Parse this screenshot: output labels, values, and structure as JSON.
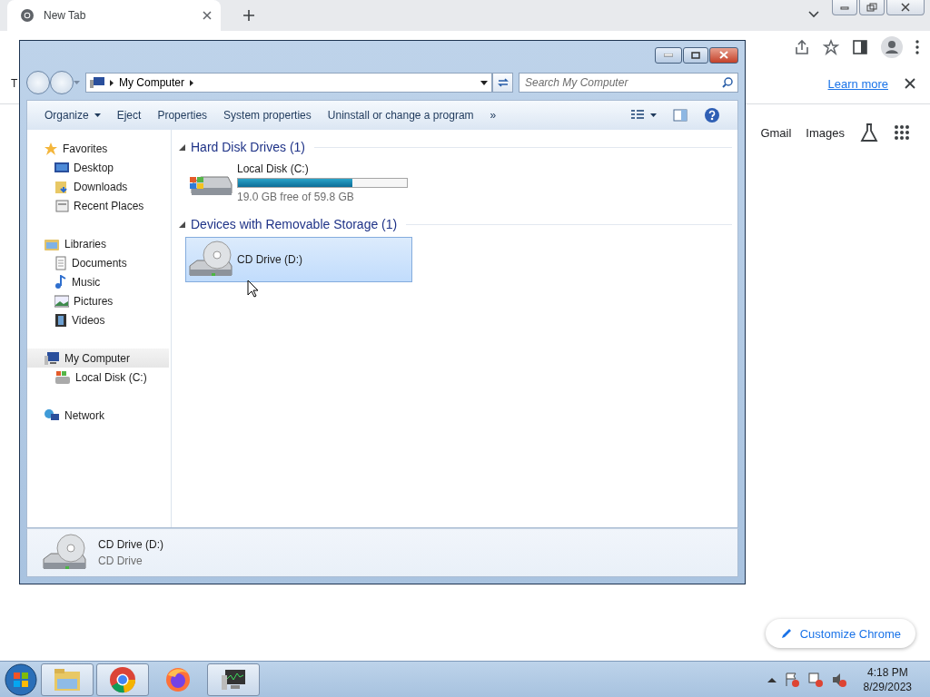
{
  "browser": {
    "tabs": [
      {
        "title": "New Tab",
        "selected": true
      }
    ],
    "infobar": {
      "text": "T",
      "link": "Learn more"
    },
    "links": [
      "Gmail",
      "Images"
    ],
    "customize": "Customize Chrome"
  },
  "explorer": {
    "address": [
      "My Computer"
    ],
    "search": {
      "placeholder": "Search My Computer"
    },
    "toolbar": [
      {
        "label": "Organize",
        "dropdown": true
      },
      {
        "label": "Eject",
        "dropdown": false
      },
      {
        "label": "Properties",
        "dropdown": false
      },
      {
        "label": "System properties",
        "dropdown": false
      },
      {
        "label": "Uninstall or change a program",
        "dropdown": false
      }
    ],
    "overflow": "»",
    "nav": [
      {
        "label": "Favorites",
        "kind": "star",
        "selected": false,
        "children": [
          {
            "label": "Desktop",
            "kind": "desktop",
            "selected": false
          },
          {
            "label": "Downloads",
            "kind": "download",
            "selected": false
          },
          {
            "label": "Recent Places",
            "kind": "recent",
            "selected": false
          }
        ]
      },
      {
        "label": "Libraries",
        "kind": "library",
        "selected": false,
        "children": [
          {
            "label": "Documents",
            "kind": "document",
            "selected": false
          },
          {
            "label": "Music",
            "kind": "music",
            "selected": false
          },
          {
            "label": "Pictures",
            "kind": "pictures",
            "selected": false
          },
          {
            "label": "Videos",
            "kind": "video",
            "selected": false
          }
        ]
      },
      {
        "label": "My Computer",
        "kind": "computer",
        "selected": true,
        "children": [
          {
            "label": "Local Disk (C:)",
            "kind": "disk",
            "selected": false
          }
        ]
      },
      {
        "label": "Network",
        "kind": "network",
        "selected": false
      }
    ],
    "groups": [
      {
        "title": "Hard Disk Drives (1)",
        "expanded": true,
        "items": [
          {
            "name": "Local Disk (C:)",
            "kind": "disk",
            "level": 0.68,
            "free": "19.0 GB free of 59.8 GB",
            "selected": false
          }
        ]
      },
      {
        "title": "Devices with Removable Storage (1)",
        "expanded": true,
        "items": [
          {
            "name": "CD Drive (D:)",
            "kind": "cd",
            "selected": true
          }
        ]
      }
    ],
    "details": {
      "name": "CD Drive (D:)",
      "type": "CD Drive",
      "kind": "cd"
    }
  },
  "taskbar": {
    "apps": [
      {
        "kind": "folder",
        "selected": true
      },
      {
        "kind": "chrome",
        "selected": true
      },
      {
        "kind": "firefox",
        "selected": false
      },
      {
        "kind": "monitor",
        "selected": true
      }
    ],
    "time": "4:18 PM",
    "date": "8/29/2023"
  }
}
